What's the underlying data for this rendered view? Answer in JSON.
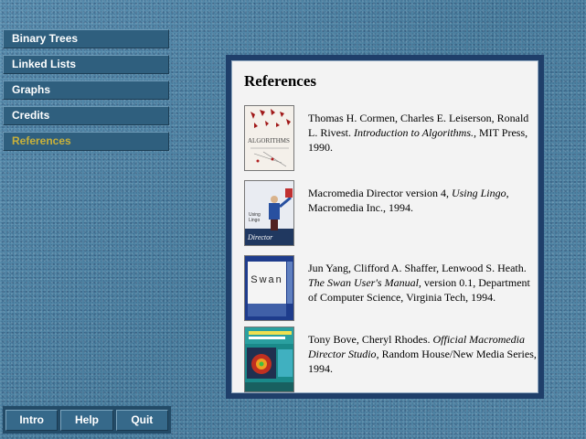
{
  "nav": {
    "items": [
      {
        "label": "Binary Trees"
      },
      {
        "label": "Linked Lists"
      },
      {
        "label": "Graphs"
      },
      {
        "label": "Credits"
      },
      {
        "label": "References"
      }
    ],
    "active": "References"
  },
  "panel": {
    "title": "References",
    "refs": [
      {
        "authors": "Thomas H. Cormen, Charles E. Leiserson, Ronald L. Rivest.",
        "italic": "Introduction to Algorithms.,",
        "rest": "MIT Press, 1990.",
        "cover_icon": "algorithms-book-cover"
      },
      {
        "authors": "Macromedia Director version 4,",
        "italic": "Using Lingo",
        "rest": ", Macromedia Inc., 1994.",
        "cover_icon": "director-book-cover"
      },
      {
        "authors": "Jun Yang, Clifford A. Shaffer, Lenwood S. Heath.",
        "italic": "The Swan User's Manual,",
        "rest": "version 0.1, Department of Computer Science, Virginia Tech, 1994.",
        "cover_icon": "swan-manual-cover",
        "cover_text": "Swan"
      },
      {
        "authors": "Tony Bove, Cheryl Rhodes.",
        "italic": "Official Macromedia Director Studio",
        "rest": ", Random House/New Media Series, 1994.",
        "cover_icon": "director-studio-cover"
      }
    ]
  },
  "bottom": {
    "intro_label": "Intro",
    "help_label": "Help",
    "quit_label": "Quit"
  },
  "colors": {
    "active_nav": "#c9b13a",
    "panel_frame": "#1f3f6a",
    "nav_bg": "#2f5f7e"
  }
}
